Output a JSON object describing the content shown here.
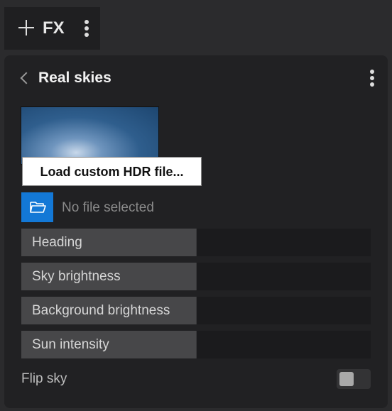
{
  "toolbar": {
    "add_icon": "plus-icon",
    "label": "FX",
    "menu_icon": "kebab-menu-icon"
  },
  "panel": {
    "back_icon": "chevron-left-icon",
    "title": "Real skies",
    "menu_icon": "kebab-menu-icon",
    "tooltip": "Load custom HDR file...",
    "file_button_icon": "folder-open-icon",
    "file_status": "No file selected",
    "sliders": [
      {
        "label": "Heading",
        "value": 0.5
      },
      {
        "label": "Sky brightness",
        "value": 0.5
      },
      {
        "label": "Background brightness",
        "value": 0.5
      },
      {
        "label": "Sun intensity",
        "value": 0.5
      }
    ],
    "flip_sky": {
      "label": "Flip sky",
      "on": false
    }
  }
}
